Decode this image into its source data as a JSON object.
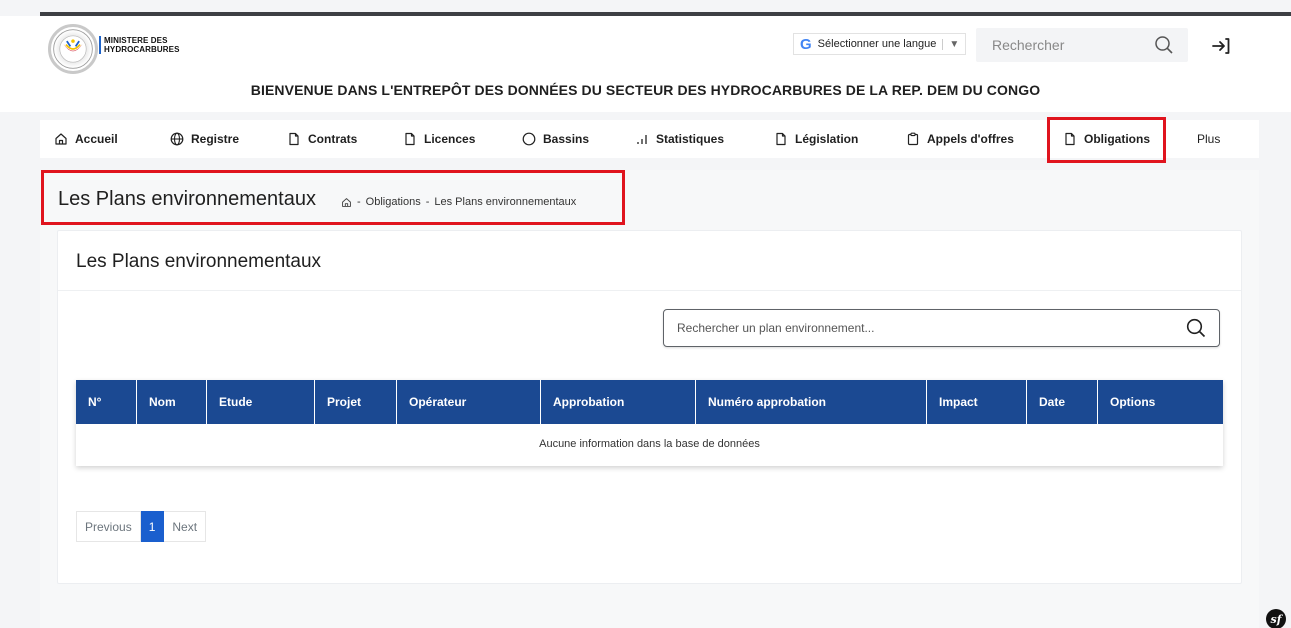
{
  "header": {
    "ministry_line1": "MINISTERE DES",
    "ministry_line2": "HYDROCARBURES",
    "language_label": "Sélectionner une langue",
    "language_arrow": "▼",
    "google_glyph": "G",
    "search_placeholder": "Rechercher",
    "welcome_text": "BIENVENUE DANS L'ENTREPÔT DES DONNÉES DU SECTEUR DES HYDROCARBURES DE LA REP. DEM DU CONGO"
  },
  "nav": {
    "items": [
      {
        "label": "Accueil",
        "icon": "home-icon"
      },
      {
        "label": "Registre",
        "icon": "globe-icon"
      },
      {
        "label": "Contrats",
        "icon": "document-icon"
      },
      {
        "label": "Licences",
        "icon": "document-icon"
      },
      {
        "label": "Bassins",
        "icon": "circle-icon"
      },
      {
        "label": "Statistiques",
        "icon": "bar-chart-icon"
      },
      {
        "label": "Législation",
        "icon": "document-icon"
      },
      {
        "label": "Appels d'offres",
        "icon": "clipboard-icon"
      },
      {
        "label": "Obligations",
        "icon": "document-icon",
        "active": true
      },
      {
        "label": "Plus",
        "icon": ""
      }
    ]
  },
  "page": {
    "title": "Les Plans environnementaux",
    "breadcrumb": {
      "sep1": "-",
      "item1": "Obligations",
      "sep2": "-",
      "item2": "Les Plans environnementaux"
    }
  },
  "card": {
    "title": "Les Plans environnementaux",
    "search_placeholder": "Rechercher un plan environnement...",
    "table": {
      "columns": [
        "N°",
        "Nom",
        "Etude",
        "Projet",
        "Opérateur",
        "Approbation",
        "Numéro approbation",
        "Impact",
        "Date",
        "Options"
      ],
      "empty_message": "Aucune information dans la base de données"
    },
    "pagination": {
      "previous": "Previous",
      "current": "1",
      "next": "Next"
    }
  },
  "footer": {
    "symfony_badge": "sf"
  },
  "colors": {
    "table_header": "#1b4992",
    "highlight_box": "#e0141e",
    "pager_active": "#1a5fce"
  }
}
